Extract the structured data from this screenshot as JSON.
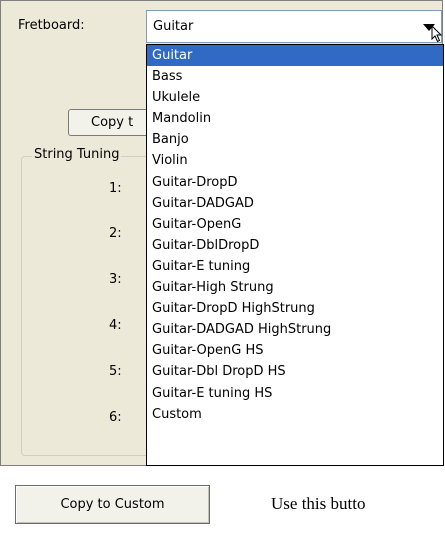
{
  "fretboard": {
    "label": "Fretboard:",
    "selected": "Guitar",
    "options": [
      "Guitar",
      "Bass",
      "Ukulele",
      "Mandolin",
      "Banjo",
      "Violin",
      "Guitar-DropD",
      "Guitar-DADGAD",
      "Guitar-OpenG",
      "Guitar-DblDropD",
      "Guitar-E tuning",
      "Guitar-High Strung",
      "Guitar-DropD HighStrung",
      "Guitar-DADGAD HighStrung",
      "Guitar-OpenG HS",
      "Guitar-Dbl DropD HS",
      "Guitar-E tuning HS",
      "Custom"
    ]
  },
  "copy_button_partial": "Copy t",
  "string_tuning": {
    "title": "String Tuning",
    "strings": [
      "1:",
      "2:",
      "3:",
      "4:",
      "5:",
      "6:"
    ]
  },
  "copy_to_custom": "Copy to Custom",
  "description_text": "Use this butto",
  "colors": {
    "selection": "#316ac5",
    "panel": "#ece9d8"
  }
}
